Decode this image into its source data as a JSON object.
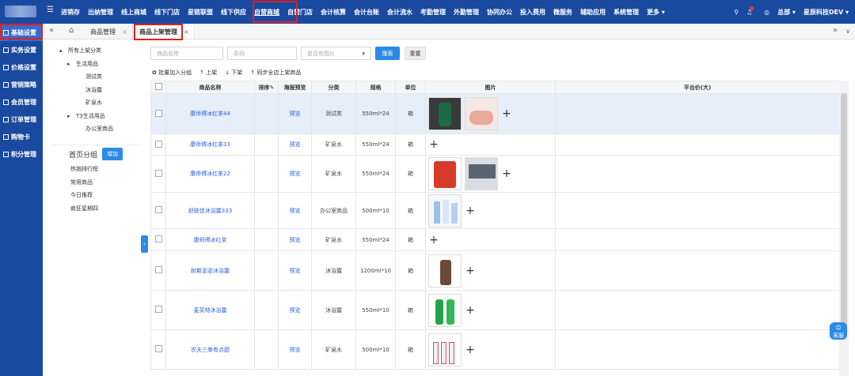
{
  "nav": {
    "items": [
      "进销存",
      "出纳管理",
      "线上商城",
      "线下门店",
      "星链联盟",
      "线下供应",
      "自营商城",
      "自营门店",
      "会计核算",
      "会计台账",
      "会计流水",
      "考勤管理",
      "外勤管理",
      "协同办公",
      "投入费用",
      "微服务",
      "辅助应用",
      "系统管理",
      "更多 ▾"
    ],
    "active_index": 6,
    "user": "总部 ▾",
    "company": "星辰科技DEV ▾",
    "search_icon": "search-icon",
    "bell_icon": "bell-icon"
  },
  "sidebar": {
    "items": [
      "基础设置",
      "实务设置",
      "价格设置",
      "营销策略",
      "会员管理",
      "订单管理",
      "购物卡",
      "积分管理"
    ],
    "active_index": 0
  },
  "tabs": {
    "items": [
      {
        "label": "商品管理",
        "close": "×"
      },
      {
        "label": "商品上架管理",
        "close": "×"
      }
    ],
    "active_index": 1,
    "prev": "«",
    "next": "»",
    "more": "∨"
  },
  "tree": {
    "nodes": [
      {
        "label": "所有上架分类",
        "prefix": "▴"
      },
      {
        "label": "生活用品",
        "prefix": "▸"
      },
      {
        "label": "测试类",
        "prefix": ""
      },
      {
        "label": "沐浴露",
        "prefix": ""
      },
      {
        "label": "矿泉水",
        "prefix": ""
      },
      {
        "label": "T3生活用品",
        "prefix": "▸"
      },
      {
        "label": "办公室商品",
        "prefix": ""
      }
    ]
  },
  "groups": {
    "title": "首页分组",
    "add_label": "增加",
    "items": [
      "热销排行榜",
      "常用商品",
      "今日推荐",
      "疯狂星期四"
    ]
  },
  "filters": {
    "name_placeholder": "商品名称",
    "code_placeholder": "条码",
    "has_image_placeholder": "是否有图片",
    "select_arrow": "▾",
    "search_label": "搜索",
    "reset_label": "重置"
  },
  "actions": {
    "batch_add": "✿ 批量加入分组",
    "on_shelf": "↑ 上架",
    "off_shelf": "↓ 下架",
    "sync": "↑ 同步全店上架商品"
  },
  "table": {
    "headers": [
      "商品名称",
      "排序✎",
      "海报预览",
      "分类",
      "规格",
      "单位",
      "图片",
      "平台价(大)"
    ],
    "rows": [
      {
        "name": "康师傅冰红茶44",
        "preview": "预览",
        "category": "测试类",
        "spec": "550ml*24",
        "unit": "箱",
        "images": 2
      },
      {
        "name": "康师傅冰红茶33",
        "preview": "预览",
        "category": "矿泉水",
        "spec": "550ml*24",
        "unit": "箱",
        "images": 0
      },
      {
        "name": "康师傅冰红茶22",
        "preview": "预览",
        "category": "矿泉水",
        "spec": "550ml*24",
        "unit": "箱",
        "images": 2
      },
      {
        "name": "舒肤佳沐浴露333",
        "preview": "预览",
        "category": "办公室商品",
        "spec": "500ml*10",
        "unit": "箱",
        "images": 1
      },
      {
        "name": "康师傅冰红茶",
        "preview": "预览",
        "category": "矿泉水",
        "spec": "550ml*24",
        "unit": "箱",
        "images": 0
      },
      {
        "name": "耐斯澎澎沐浴露",
        "preview": "预览",
        "category": "沐浴露",
        "spec": "1200ml*10",
        "unit": "箱",
        "images": 1
      },
      {
        "name": "麦芙特沐浴露",
        "preview": "预览",
        "category": "沐浴露",
        "spec": "550ml*10",
        "unit": "箱",
        "images": 1
      },
      {
        "name": "农夫三拳有点甜",
        "preview": "预览",
        "category": "矿泉水",
        "spec": "500ml*10",
        "unit": "箱",
        "images": 1
      }
    ]
  },
  "chat": {
    "label": "客服"
  }
}
